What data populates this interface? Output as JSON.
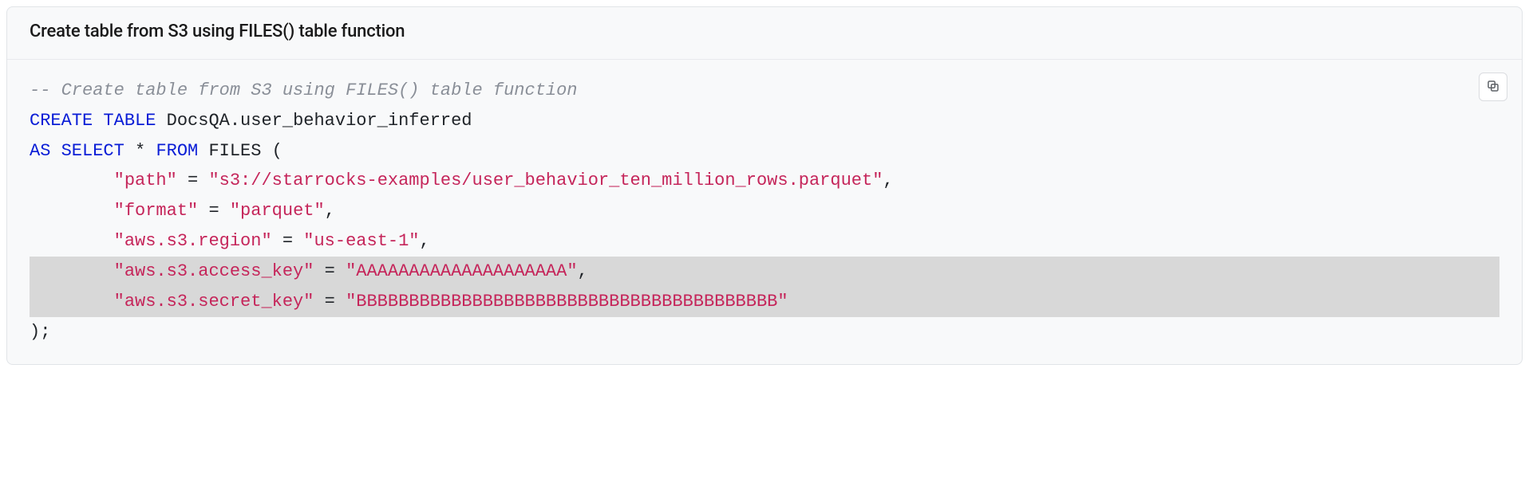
{
  "panel": {
    "title": "Create table from S3 using FILES() table function"
  },
  "icons": {
    "copy": "copy"
  },
  "code": {
    "comment_prefix": "--",
    "comment_text": " Create table from S3 using FILES() table function",
    "kw_create": "CREATE",
    "kw_table": "TABLE",
    "table_name": " DocsQA.user_behavior_inferred",
    "kw_as": "AS",
    "kw_select": "SELECT",
    "star": " * ",
    "kw_from": "FROM",
    "files_fn": " FILES ",
    "lparen": "(",
    "rparen": ");",
    "indent": "        ",
    "eq": " = ",
    "comma": ",",
    "path_key": "\"path\"",
    "path_val": "\"s3://starrocks-examples/user_behavior_ten_million_rows.parquet\"",
    "format_key": "\"format\"",
    "format_val": "\"parquet\"",
    "region_key": "\"aws.s3.region\"",
    "region_val": "\"us-east-1\"",
    "access_key_key": "\"aws.s3.access_key\"",
    "access_key_val": "\"AAAAAAAAAAAAAAAAAAAA\"",
    "secret_key_key": "\"aws.s3.secret_key\"",
    "secret_key_val": "\"BBBBBBBBBBBBBBBBBBBBBBBBBBBBBBBBBBBBBBBB\""
  }
}
